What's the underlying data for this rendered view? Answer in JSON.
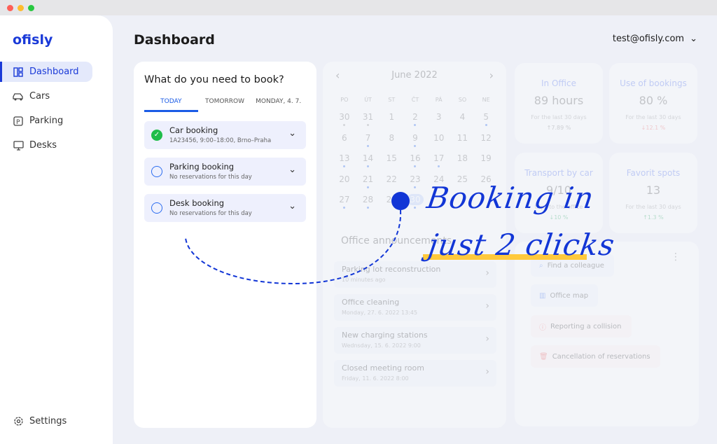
{
  "window": {
    "controls": [
      "#fe5f57",
      "#febc2e",
      "#28c840"
    ]
  },
  "sidebar": {
    "logo": "ofisly",
    "items": [
      {
        "label": "Dashboard",
        "icon": "dashboard-icon",
        "active": true
      },
      {
        "label": "Cars",
        "icon": "car-icon"
      },
      {
        "label": "Parking",
        "icon": "parking-icon"
      },
      {
        "label": "Desks",
        "icon": "desk-monitor-icon"
      }
    ],
    "settings": "Settings"
  },
  "header": {
    "title": "Dashboard",
    "user": "test@ofisly.com"
  },
  "booking": {
    "title": "What do you need to book?",
    "tabs": [
      "TODAY",
      "TOMORROW",
      "MONDAY, 4. 7."
    ],
    "active_tab": 0,
    "items": [
      {
        "title": "Car booking",
        "subtitle": "1A23456, 9:00–18:00, Brno–Praha",
        "done": true
      },
      {
        "title": "Parking booking",
        "subtitle": "No reservations for this day",
        "done": false
      },
      {
        "title": "Desk booking",
        "subtitle": "No reservations for this day",
        "done": false
      }
    ]
  },
  "calendar": {
    "month": "June 2022",
    "weekdays": [
      "PO",
      "ÚT",
      "ST",
      "ČT",
      "PÁ",
      "SO",
      "NE"
    ],
    "selected": "30",
    "days": [
      [
        "30",
        "g"
      ],
      [
        "31",
        "g"
      ],
      [
        "1",
        ""
      ],
      [
        "2",
        "b"
      ],
      [
        "3",
        ""
      ],
      [
        "4",
        ""
      ],
      [
        "5",
        "b"
      ],
      [
        "6",
        ""
      ],
      [
        "7",
        "b"
      ],
      [
        "8",
        ""
      ],
      [
        "9",
        "b"
      ],
      [
        "10",
        ""
      ],
      [
        "11",
        ""
      ],
      [
        "12",
        ""
      ],
      [
        "13",
        "b"
      ],
      [
        "14",
        "b"
      ],
      [
        "15",
        ""
      ],
      [
        "16",
        "b"
      ],
      [
        "17",
        "b"
      ],
      [
        "18",
        ""
      ],
      [
        "19",
        ""
      ],
      [
        "20",
        ""
      ],
      [
        "21",
        "b"
      ],
      [
        "22",
        ""
      ],
      [
        "23",
        "b"
      ],
      [
        "24",
        ""
      ],
      [
        "25",
        ""
      ],
      [
        "26",
        ""
      ],
      [
        "27",
        "b"
      ],
      [
        "28",
        "b"
      ],
      [
        "29",
        ""
      ],
      [
        "30",
        "b"
      ]
    ]
  },
  "stats": [
    {
      "label": "In Office",
      "value": "89 hours",
      "period": "For the last 30 days",
      "change": "↑7.89 %",
      "change_color": "#888888"
    },
    {
      "label": "Use of bookings",
      "value": "80 %",
      "period": "For the last 30 days",
      "change": "↓12.1 %",
      "change_color": "#f07070"
    },
    {
      "label": "Transport by car",
      "value": "9/10",
      "period": "trips to the office",
      "change": "↓10 %",
      "change_color": "#40b070"
    },
    {
      "label": "Favorit spots",
      "value": "13",
      "period": "For the last 30 days",
      "change": "↑1.3 %",
      "change_color": "#40b070"
    }
  ],
  "announcements": {
    "title": "Office announcements",
    "items": [
      {
        "title": "Parking lot reconstruction",
        "time": "10 minutes ago"
      },
      {
        "title": "Office cleaning",
        "time": "Monday, 27. 6. 2022 13:45"
      },
      {
        "title": "New charging stations",
        "time": "Wednsday, 15. 6. 2022 9:00"
      },
      {
        "title": "Closed meeting room",
        "time": "Friday, 11. 6. 2022 8:00"
      }
    ]
  },
  "actions": [
    {
      "label": "Find a colleague",
      "icon": "search-icon",
      "bg": "#f2f5fd",
      "color": "#4a7af0"
    },
    {
      "label": "Office map",
      "icon": "map-icon",
      "bg": "#f2f5fd",
      "color": "#4a7af0"
    },
    {
      "label": "Reporting a collision",
      "icon": "alert-icon",
      "bg": "#fdf2f2",
      "color": "#f06060"
    },
    {
      "label": "Cancellation of reservations",
      "icon": "trash-icon",
      "bg": "#fdf3f2",
      "color": "#f06060"
    }
  ],
  "promo": {
    "line1": "Booking in",
    "line2": "just 2 clicks",
    "accent": "#1236d6",
    "underline": "#ffc93c"
  }
}
